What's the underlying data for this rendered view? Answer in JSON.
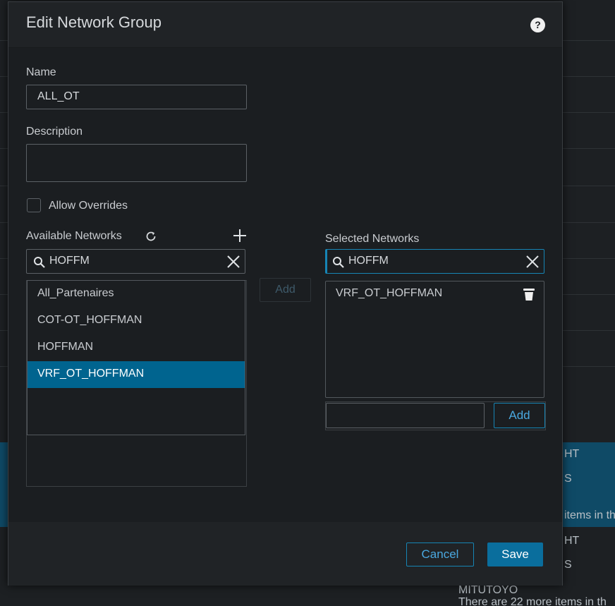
{
  "background": {
    "rows": [
      {
        "text": "HT"
      },
      {
        "text": "S"
      },
      {
        "text": "items in th"
      },
      {
        "text": "HT"
      },
      {
        "text": "S"
      },
      {
        "text": "MITUTOYO"
      },
      {
        "text": "There are 22 more items in th"
      }
    ]
  },
  "modal": {
    "title": "Edit Network Group",
    "help_icon": "question-circle-icon",
    "name_label": "Name",
    "name_value": "ALL_OT",
    "description_label": "Description",
    "description_value": "",
    "allow_overrides_label": "Allow Overrides",
    "allow_overrides_checked": false,
    "available": {
      "label": "Available Networks",
      "refresh_icon": "refresh-icon",
      "add_icon": "plus-icon",
      "search_value": "HOFFM",
      "items": [
        {
          "label": "All_Partenaires",
          "selected": false
        },
        {
          "label": "COT-OT_HOFFMAN",
          "selected": false
        },
        {
          "label": "HOFFMAN",
          "selected": false
        },
        {
          "label": "VRF_OT_HOFFMAN",
          "selected": true
        }
      ],
      "add_button": "Add"
    },
    "selected": {
      "label": "Selected Networks",
      "search_value": "HOFFM",
      "items": [
        {
          "label": "VRF_OT_HOFFMAN"
        }
      ],
      "manual_input_value": "",
      "add_button": "Add"
    },
    "footer": {
      "cancel": "Cancel",
      "save": "Save"
    }
  },
  "colors": {
    "accent": "#1685b5",
    "selected_row": "#00648f",
    "save_button": "#0a6e9d"
  }
}
